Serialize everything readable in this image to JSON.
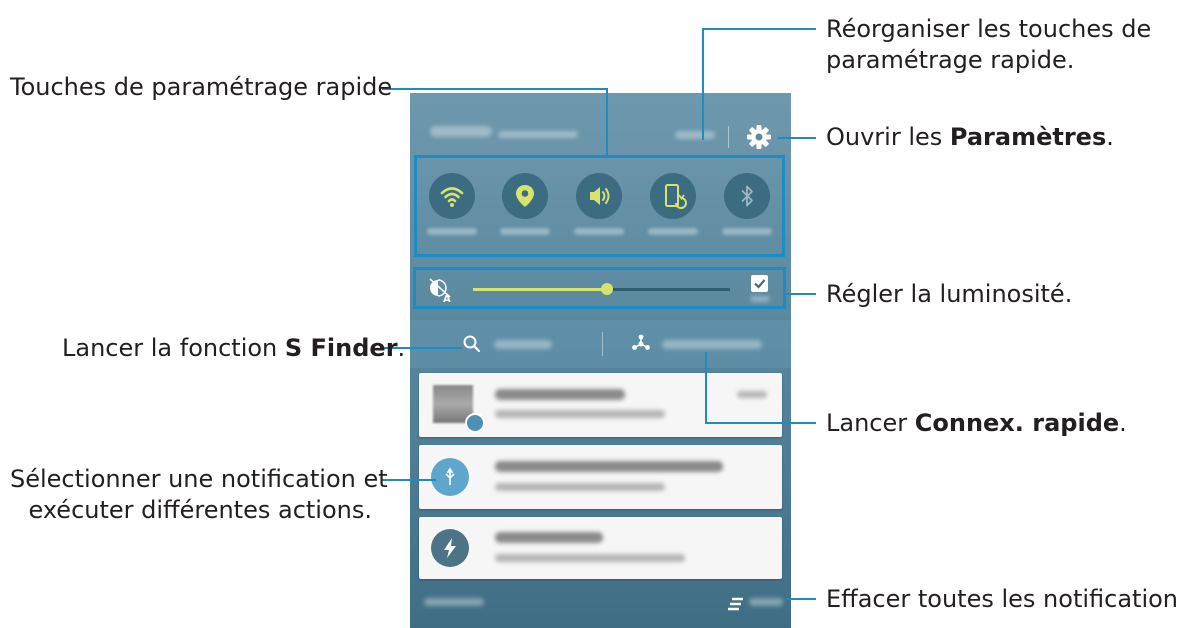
{
  "annotations": {
    "reorder_line1": "Réorganiser les touches de",
    "reorder_line2": "paramétrage rapide.",
    "quick_settings": "Touches de paramétrage rapide",
    "settings_prefix": "Ouvrir les ",
    "settings_bold": "Paramètres",
    "settings_suffix": ".",
    "brightness": "Régler la luminosité.",
    "sfinder_prefix": "Lancer la fonction ",
    "sfinder_bold": "S Finder",
    "sfinder_suffix": ".",
    "quick_connect_prefix": "Lancer ",
    "quick_connect_bold": "Connex. rapide",
    "quick_connect_suffix": ".",
    "notification_line1": "Sélectionner une notification et",
    "notification_line2": "exécuter différentes actions.",
    "clear_all": "Effacer toutes les notifications."
  },
  "phone": {
    "quick_settings": [
      {
        "icon": "wifi-icon"
      },
      {
        "icon": "location-icon"
      },
      {
        "icon": "sound-icon"
      },
      {
        "icon": "screen-rotation-icon"
      },
      {
        "icon": "bluetooth-icon"
      }
    ],
    "brightness_level": 0.52,
    "colors": {
      "accent": "#1e8bc3",
      "active_icon": "#d7e36a",
      "button_bg": "#3b6c82",
      "panel": "#5b8aa0"
    }
  }
}
